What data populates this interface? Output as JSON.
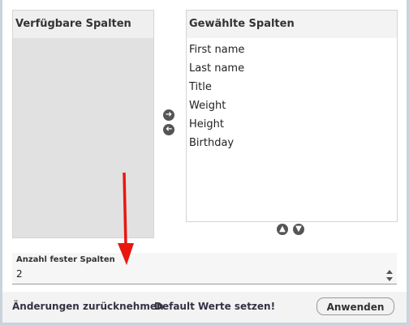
{
  "available_panel": {
    "title": "Verfügbare Spalten",
    "items": []
  },
  "selected_panel": {
    "title": "Gewählte Spalten",
    "items": [
      "First name",
      "Last name",
      "Title",
      "Weight",
      "Height",
      "Birthday"
    ]
  },
  "controls": {
    "move_right_icon": "arrow-right-circle-icon",
    "move_left_icon": "arrow-left-circle-icon",
    "move_up_icon": "arrow-up-circle-icon",
    "move_down_icon": "arrow-down-circle-icon"
  },
  "fixed_columns": {
    "label": "Anzahl fester Spalten",
    "value": "2"
  },
  "footer": {
    "reset_label": "Änderungen zurücknehmen",
    "defaults_label": "Default Werte setzen!",
    "apply_label": "Anwenden"
  },
  "colors": {
    "panel_gray": "#e1e1e1",
    "annotation_arrow": "#e8170f"
  }
}
